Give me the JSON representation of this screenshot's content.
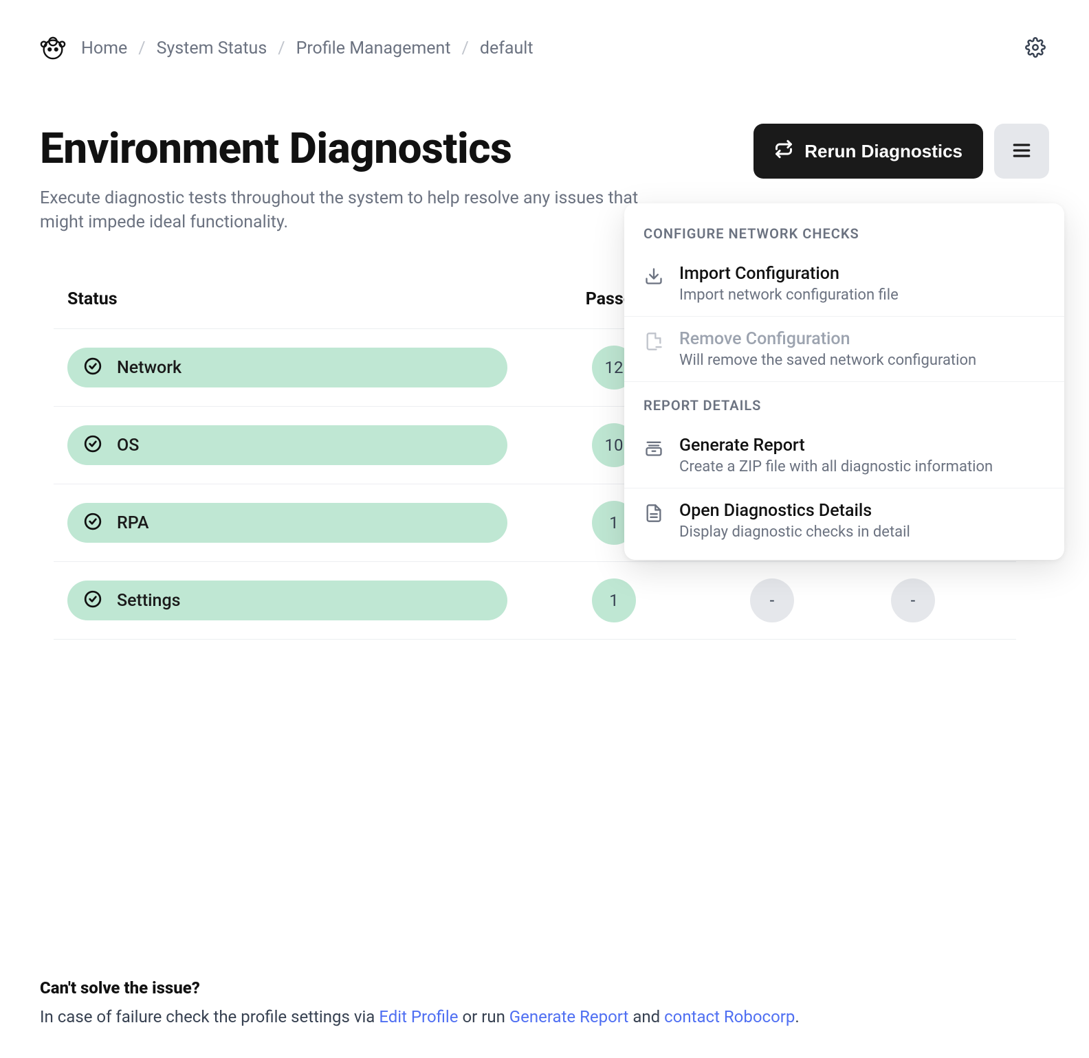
{
  "breadcrumb": {
    "items": [
      "Home",
      "System Status",
      "Profile Management",
      "default"
    ]
  },
  "page": {
    "title": "Environment Diagnostics",
    "subtitle": "Execute diagnostic tests throughout the system to help resolve any issues that might impede ideal functionality."
  },
  "actions": {
    "rerun_label": "Rerun Diagnostics"
  },
  "table": {
    "columns": {
      "status": "Status",
      "passed": "Passed"
    },
    "rows": [
      {
        "name": "Network",
        "passed": "12",
        "failed": "-",
        "warnings": "-"
      },
      {
        "name": "OS",
        "passed": "10",
        "failed": "-",
        "warnings": "-"
      },
      {
        "name": "RPA",
        "passed": "1",
        "failed": "-",
        "warnings": "-"
      },
      {
        "name": "Settings",
        "passed": "1",
        "failed": "-",
        "warnings": "-"
      }
    ]
  },
  "dropdown": {
    "section1_title": "CONFIGURE NETWORK CHECKS",
    "import": {
      "title": "Import Configuration",
      "desc": "Import network configuration file"
    },
    "remove": {
      "title": "Remove Configuration",
      "desc": "Will remove the saved network configuration"
    },
    "section2_title": "REPORT DETAILS",
    "generate": {
      "title": "Generate Report",
      "desc": "Create a ZIP file with all diagnostic information"
    },
    "open": {
      "title": "Open Diagnostics Details",
      "desc": "Display diagnostic checks in detail"
    }
  },
  "help": {
    "title": "Can't solve the issue?",
    "text_prefix": "In case of failure check the profile settings via ",
    "link1": "Edit Profile",
    "text_mid": " or run ",
    "link2": "Generate Report",
    "text_mid2": " and ",
    "link3": "contact Robocorp",
    "text_suffix": "."
  }
}
